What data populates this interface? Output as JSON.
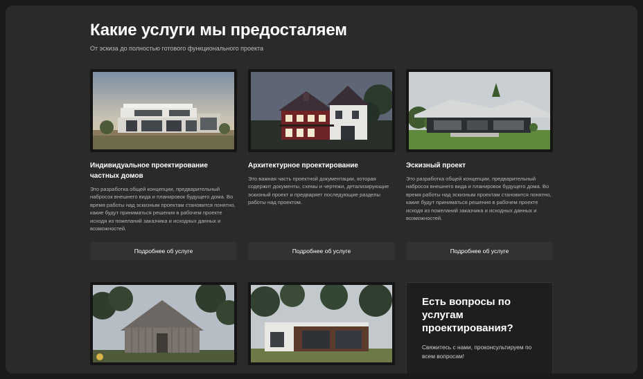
{
  "header": {
    "title": "Какие услуги мы предосталяем",
    "subtitle": "От эскиза до полностью готового функционального проекта"
  },
  "services": [
    {
      "title": "Индивидуальное проектирование частных домов",
      "description": "Это разработка общей концепции, предварительный набросок внешнего вида и планировок будущего дома. Во время работы над эскизным проектам становится понятно, какие будут приниматься решения в рабочем проекте исходя из пожеланий заказчика и исходных данных и возможностей.",
      "button": "Подробнее об услуге"
    },
    {
      "title": "Архитектурное проектирование",
      "description": "Это важная часть проектной документации, которая содержит документы, схемы и чертежи, детализирующие эскизный проект и предваряет последующие разделы работы над проектом.",
      "button": "Подробнее об услуге"
    },
    {
      "title": "Эскизный проект",
      "description": "Это разработка общей концепции, предварительный набросок внешнего вида и планировок будущего дома. Во время работы над эскизным проектам становится понятно, какие будут приниматься решения в рабочем проекте исходя из пожеланий заказчика и исходных данных и возможностей.",
      "button": "Подробнее об услуге"
    }
  ],
  "cta": {
    "question": "Есть вопросы по услугам проектирования?",
    "text": "Свяжитесь с нами, проконсультируем по всем вопросам!"
  },
  "colors": {
    "page_background": "#2a2a2a",
    "outer_background": "#1b1b1b",
    "button_background": "#323232",
    "cta_background": "#1e1e1e"
  }
}
